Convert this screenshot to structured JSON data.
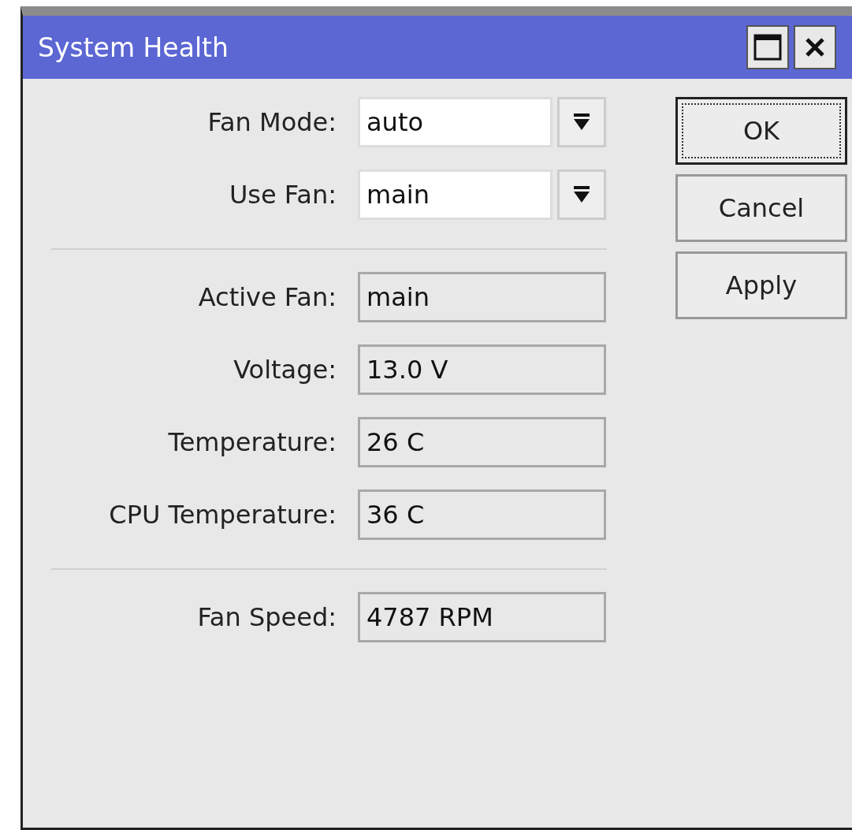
{
  "window": {
    "title": "System Health"
  },
  "groups": [
    {
      "fields": [
        {
          "label": "Fan Mode:",
          "value": "auto",
          "kind": "dropdown"
        },
        {
          "label": "Use Fan:",
          "value": "main",
          "kind": "dropdown"
        }
      ]
    },
    {
      "fields": [
        {
          "label": "Active Fan:",
          "value": "main",
          "kind": "readonly"
        },
        {
          "label": "Voltage:",
          "value": "13.0 V",
          "kind": "readonly"
        },
        {
          "label": "Temperature:",
          "value": "26 C",
          "kind": "readonly"
        },
        {
          "label": "CPU Temperature:",
          "value": "36 C",
          "kind": "readonly"
        }
      ]
    },
    {
      "fields": [
        {
          "label": "Fan Speed:",
          "value": "4787 RPM",
          "kind": "readonly"
        }
      ]
    }
  ],
  "buttons": [
    {
      "label": "OK",
      "focused": true
    },
    {
      "label": "Cancel",
      "focused": false
    },
    {
      "label": "Apply",
      "focused": false
    }
  ]
}
